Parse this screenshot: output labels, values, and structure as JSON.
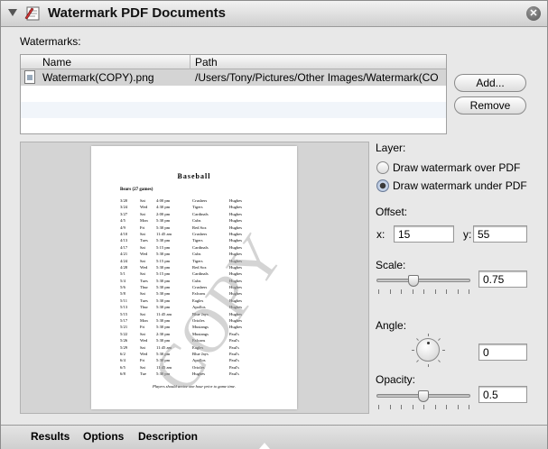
{
  "window": {
    "title": "Watermark PDF Documents",
    "close_glyph": "✕"
  },
  "watermarks": {
    "label": "Watermarks:",
    "columns": [
      "Name",
      "Path"
    ],
    "rows": [
      {
        "name": "Watermark(COPY).png",
        "path": "/Users/Tony/Pictures/Other Images/Watermark(CO"
      }
    ],
    "add_label": "Add...",
    "remove_label": "Remove"
  },
  "preview": {
    "title": "Baseball",
    "subtitle": "Bears (27 games)",
    "watermark_text": "COPY",
    "footer": "Players should arrive one hour prior to game time.",
    "schedule": [
      [
        "3/20",
        "Sat",
        "4:00 pm",
        "Crushers",
        "Hughes"
      ],
      [
        "3/24",
        "Wed",
        "4:30 pm",
        "Tigers",
        "Hughes"
      ],
      [
        "3/27",
        "Sat",
        "2:00 pm",
        "Cardinals",
        "Hughes"
      ],
      [
        "4/5",
        "Mon",
        "5:30 pm",
        "Cubs",
        "Hughes"
      ],
      [
        "4/9",
        "Fri",
        "5:30 pm",
        "Red Sox",
        "Hughes"
      ],
      [
        "4/10",
        "Sat",
        "11:45 am",
        "Crushers",
        "Hughes"
      ],
      [
        "4/13",
        "Tues",
        "5:30 pm",
        "Tigers",
        "Hughes"
      ],
      [
        "4/17",
        "Sat",
        "5:15 pm",
        "Cardinals",
        "Hughes"
      ],
      [
        "4/21",
        "Wed",
        "5:30 pm",
        "Cubs",
        "Hughes"
      ],
      [
        "4/24",
        "Sat",
        "5:15 pm",
        "Tigers",
        "Hughes"
      ],
      [
        "4/28",
        "Wed",
        "5:30 pm",
        "Red Sox",
        "Hughes"
      ],
      [
        "5/1",
        "Sat",
        "5:15 pm",
        "Cardinals",
        "Hughes"
      ],
      [
        "5/4",
        "Tues",
        "5:30 pm",
        "Cubs",
        "Hughes"
      ],
      [
        "5/6",
        "Thur",
        "5:30 pm",
        "Crushers",
        "Hughes"
      ],
      [
        "5/8",
        "Sat",
        "5:30 pm",
        "Falcons",
        "Hughes"
      ],
      [
        "5/11",
        "Tues",
        "5:30 pm",
        "Eagles",
        "Hughes"
      ],
      [
        "5/13",
        "Thur",
        "5:30 pm",
        "Apollos",
        "Hughes"
      ],
      [
        "5/15",
        "Sat",
        "11:45 am",
        "Blue Jays",
        "Hughes"
      ],
      [
        "5/17",
        "Mon",
        "5:30 pm",
        "Orioles",
        "Hughes"
      ],
      [
        "5/21",
        "Fri",
        "5:30 pm",
        "Mustangs",
        "Hughes"
      ],
      [
        "5/22",
        "Sat",
        "2:30 pm",
        "Mustangs",
        "Paul's"
      ],
      [
        "5/26",
        "Wed",
        "5:30 pm",
        "Falcons",
        "Paul's"
      ],
      [
        "5/29",
        "Sat",
        "11:45 am",
        "Eagles",
        "Paul's"
      ],
      [
        "6/2",
        "Wed",
        "5:30 pm",
        "Blue Jays",
        "Paul's"
      ],
      [
        "6/4",
        "Fri",
        "5:30 pm",
        "Apollos",
        "Paul's"
      ],
      [
        "6/5",
        "Sat",
        "11:45 am",
        "Orioles",
        "Paul's"
      ],
      [
        "6/8",
        "Tue",
        "5:30 pm",
        "Hughes",
        "Paul's"
      ]
    ]
  },
  "layer": {
    "label": "Layer:",
    "options": [
      "Draw watermark over PDF",
      "Draw watermark under PDF"
    ],
    "selected_index": 1
  },
  "offset": {
    "label": "Offset:",
    "x_label": "x:",
    "x_value": "15",
    "y_label": "y:",
    "y_value": "55"
  },
  "scale": {
    "label": "Scale:",
    "value": "0.75",
    "slider_fraction": 0.38
  },
  "angle": {
    "label": "Angle:",
    "value": "0"
  },
  "opacity": {
    "label": "Opacity:",
    "value": "0.5",
    "slider_fraction": 0.5
  },
  "tabs": [
    "Results",
    "Options",
    "Description"
  ]
}
